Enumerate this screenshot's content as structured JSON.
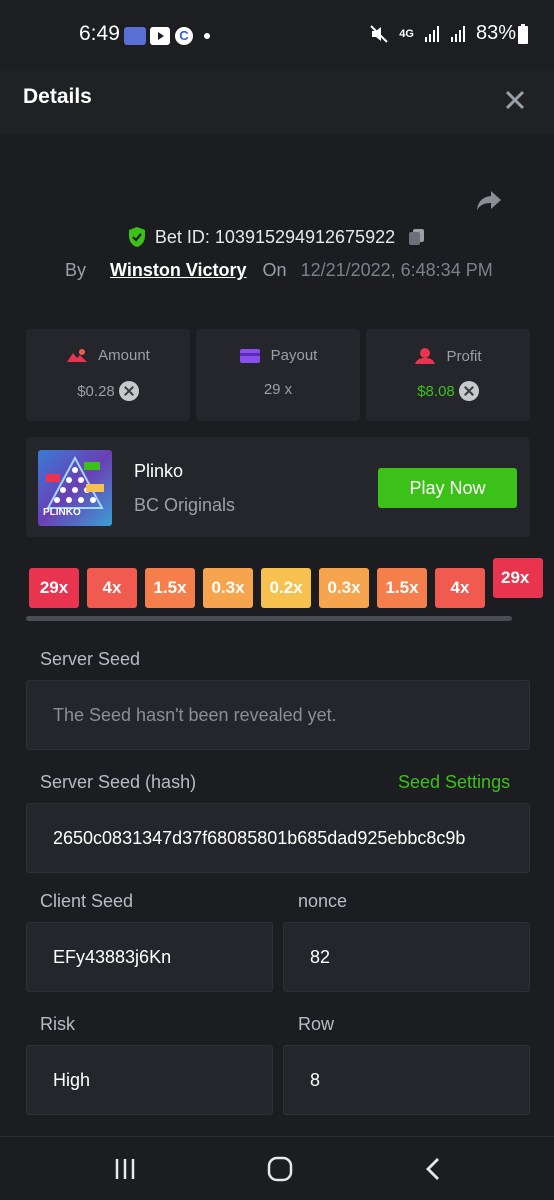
{
  "status_bar": {
    "time": "6:49",
    "network": "4G",
    "battery": "83%"
  },
  "header": {
    "title": "Details"
  },
  "bet": {
    "id_label": "Bet ID: 103915294912675922",
    "by_label": "By",
    "user": "Winston Victory",
    "on_label": "On",
    "datetime": "12/21/2022, 6:48:34 PM"
  },
  "stats": [
    {
      "label": "Amount",
      "value": "$0.28",
      "value_color": "#9aa0a6"
    },
    {
      "label": "Payout",
      "value": "29 x",
      "value_color": "#9aa0a6"
    },
    {
      "label": "Profit",
      "value": "$8.08",
      "value_color": "#3bc117"
    }
  ],
  "game": {
    "title": "Plinko",
    "subtitle": "BC Originals",
    "play_label": "Play Now",
    "thumb_text": "PLINKO"
  },
  "multipliers": [
    {
      "label": "29x",
      "color": "#e8344e"
    },
    {
      "label": "4x",
      "color": "#f05a4f"
    },
    {
      "label": "1.5x",
      "color": "#f47f4c"
    },
    {
      "label": "0.3x",
      "color": "#f6a54e"
    },
    {
      "label": "0.2x",
      "color": "#f7c150"
    },
    {
      "label": "0.3x",
      "color": "#f6a54e"
    },
    {
      "label": "1.5x",
      "color": "#f47f4c"
    },
    {
      "label": "4x",
      "color": "#f05a4f"
    },
    {
      "label": "29x",
      "color": "#e8344e"
    }
  ],
  "seeds": {
    "server_seed_label": "Server Seed",
    "server_seed_value": "The Seed hasn't been revealed yet.",
    "server_hash_label": "Server Seed (hash)",
    "seed_settings_label": "Seed Settings",
    "server_hash_value": "2650c0831347d37f68085801b685dad925ebbc8c9b",
    "client_seed_label": "Client Seed",
    "client_seed_value": "EFy43883j6Kn",
    "nonce_label": "nonce",
    "nonce_value": "82",
    "risk_label": "Risk",
    "risk_value": "High",
    "row_label": "Row",
    "row_value": "8"
  },
  "colors": {
    "accent_green": "#3bc117",
    "background": "#1b1d21",
    "card": "#24262b"
  }
}
